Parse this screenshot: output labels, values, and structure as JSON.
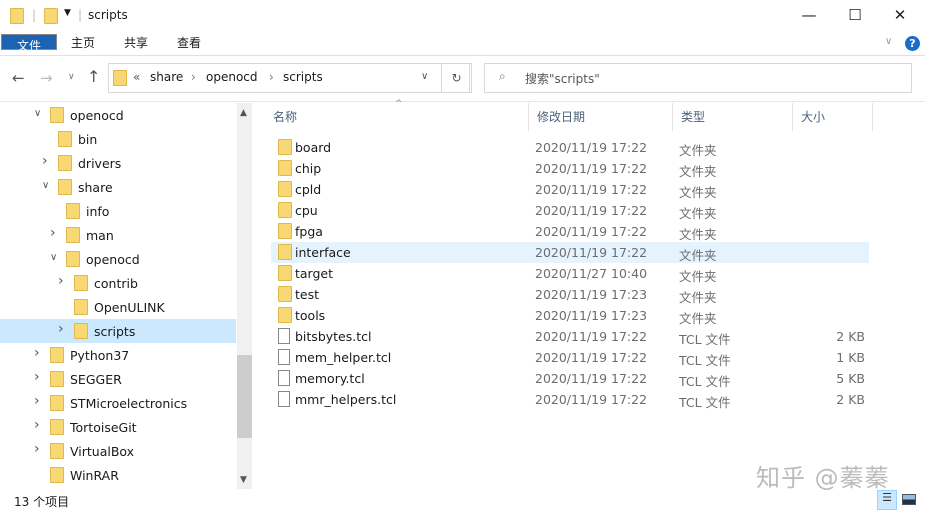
{
  "window": {
    "title": "scripts"
  },
  "ribbon": {
    "tabs": [
      "文件",
      "主页",
      "共享",
      "查看"
    ]
  },
  "address": {
    "prefix": "«",
    "crumbs": [
      "share",
      "openocd",
      "scripts"
    ]
  },
  "search": {
    "placeholder": "搜索\"scripts\""
  },
  "tree": [
    {
      "label": "openocd",
      "level": 0,
      "chev": "v"
    },
    {
      "label": "bin",
      "level": 1,
      "chev": ""
    },
    {
      "label": "drivers",
      "level": 1,
      "chev": ">"
    },
    {
      "label": "share",
      "level": 1,
      "chev": "v"
    },
    {
      "label": "info",
      "level": 2,
      "chev": ""
    },
    {
      "label": "man",
      "level": 2,
      "chev": ">"
    },
    {
      "label": "openocd",
      "level": 2,
      "chev": "v"
    },
    {
      "label": "contrib",
      "level": 3,
      "chev": ">"
    },
    {
      "label": "OpenULINK",
      "level": 3,
      "chev": ""
    },
    {
      "label": "scripts",
      "level": 3,
      "chev": ">",
      "selected": true
    },
    {
      "label": "Python37",
      "level": 0,
      "chev": ">"
    },
    {
      "label": "SEGGER",
      "level": 0,
      "chev": ">"
    },
    {
      "label": "STMicroelectronics",
      "level": 0,
      "chev": ">"
    },
    {
      "label": "TortoiseGit",
      "level": 0,
      "chev": ">"
    },
    {
      "label": "VirtualBox",
      "level": 0,
      "chev": ">"
    },
    {
      "label": "WinRAR",
      "level": 0,
      "chev": ""
    }
  ],
  "columns": [
    "名称",
    "修改日期",
    "类型",
    "大小"
  ],
  "files": [
    {
      "name": "board",
      "date": "2020/11/19 17:22",
      "type": "文件夹",
      "size": "",
      "folder": true
    },
    {
      "name": "chip",
      "date": "2020/11/19 17:22",
      "type": "文件夹",
      "size": "",
      "folder": true
    },
    {
      "name": "cpld",
      "date": "2020/11/19 17:22",
      "type": "文件夹",
      "size": "",
      "folder": true
    },
    {
      "name": "cpu",
      "date": "2020/11/19 17:22",
      "type": "文件夹",
      "size": "",
      "folder": true
    },
    {
      "name": "fpga",
      "date": "2020/11/19 17:22",
      "type": "文件夹",
      "size": "",
      "folder": true
    },
    {
      "name": "interface",
      "date": "2020/11/19 17:22",
      "type": "文件夹",
      "size": "",
      "folder": true,
      "hover": true
    },
    {
      "name": "target",
      "date": "2020/11/27 10:40",
      "type": "文件夹",
      "size": "",
      "folder": true
    },
    {
      "name": "test",
      "date": "2020/11/19 17:23",
      "type": "文件夹",
      "size": "",
      "folder": true
    },
    {
      "name": "tools",
      "date": "2020/11/19 17:23",
      "type": "文件夹",
      "size": "",
      "folder": true
    },
    {
      "name": "bitsbytes.tcl",
      "date": "2020/11/19 17:22",
      "type": "TCL 文件",
      "size": "2 KB",
      "folder": false
    },
    {
      "name": "mem_helper.tcl",
      "date": "2020/11/19 17:22",
      "type": "TCL 文件",
      "size": "1 KB",
      "folder": false
    },
    {
      "name": "memory.tcl",
      "date": "2020/11/19 17:22",
      "type": "TCL 文件",
      "size": "5 KB",
      "folder": false
    },
    {
      "name": "mmr_helpers.tcl",
      "date": "2020/11/19 17:22",
      "type": "TCL 文件",
      "size": "2 KB",
      "folder": false
    }
  ],
  "status": {
    "count": "13 个项目"
  },
  "watermark": "知乎 @蓁蓁"
}
